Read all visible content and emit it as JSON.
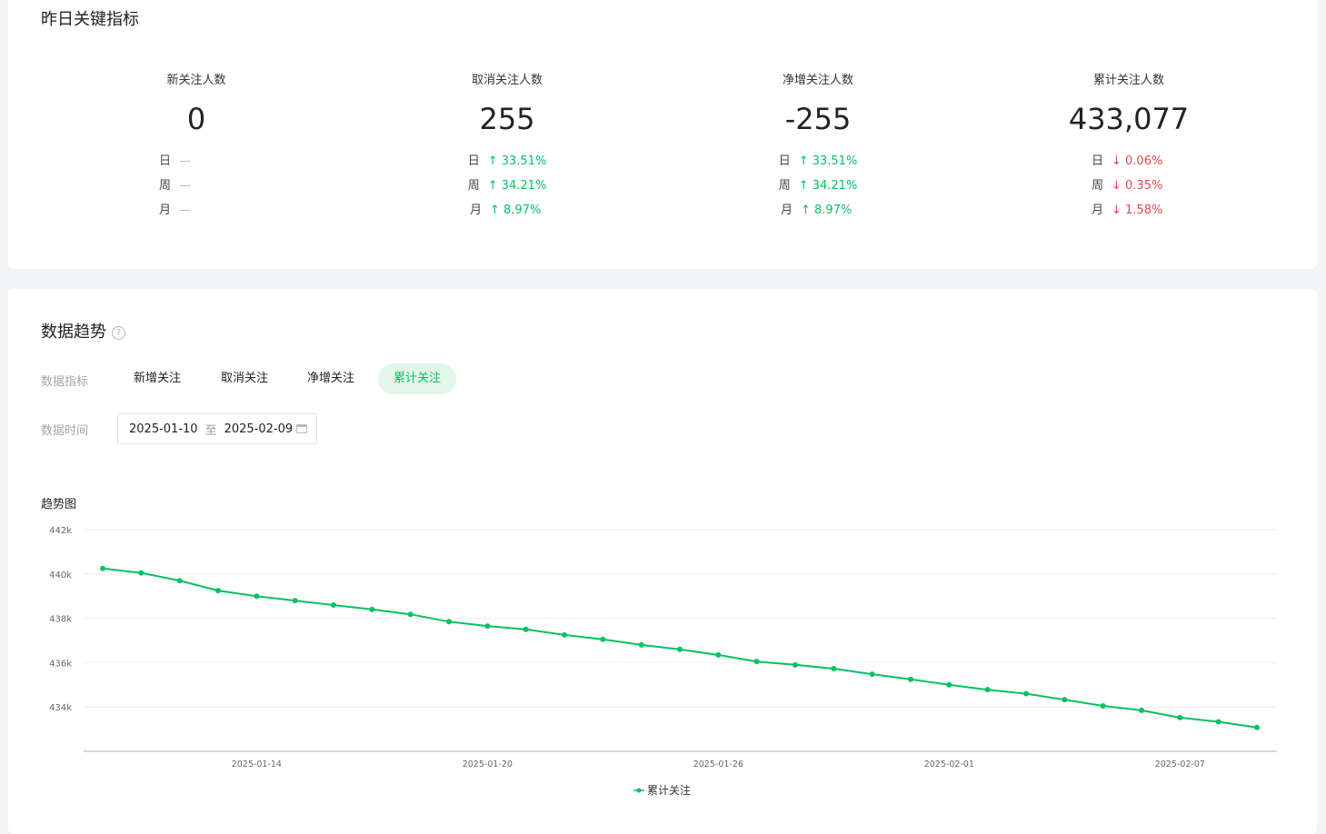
{
  "metrics_section": {
    "title": "昨日关键指标",
    "cards": [
      {
        "label": "新关注人数",
        "value": "0",
        "compare": [
          {
            "label": "日",
            "value": "—",
            "trend": "none"
          },
          {
            "label": "周",
            "value": "—",
            "trend": "none"
          },
          {
            "label": "月",
            "value": "—",
            "trend": "none"
          }
        ]
      },
      {
        "label": "取消关注人数",
        "value": "255",
        "compare": [
          {
            "label": "日",
            "value": "↑ 33.51%",
            "trend": "up"
          },
          {
            "label": "周",
            "value": "↑ 34.21%",
            "trend": "up"
          },
          {
            "label": "月",
            "value": "↑ 8.97%",
            "trend": "up"
          }
        ]
      },
      {
        "label": "净增关注人数",
        "value": "-255",
        "compare": [
          {
            "label": "日",
            "value": "↑ 33.51%",
            "trend": "up"
          },
          {
            "label": "周",
            "value": "↑ 34.21%",
            "trend": "up"
          },
          {
            "label": "月",
            "value": "↑ 8.97%",
            "trend": "up"
          }
        ]
      },
      {
        "label": "累计关注人数",
        "value": "433,077",
        "compare": [
          {
            "label": "日",
            "value": "↓ 0.06%",
            "trend": "down"
          },
          {
            "label": "周",
            "value": "↓ 0.35%",
            "trend": "down"
          },
          {
            "label": "月",
            "value": "↓ 1.58%",
            "trend": "down"
          }
        ]
      }
    ]
  },
  "trend_section": {
    "title": "数据趋势",
    "help_icon": "?",
    "metric_filter_label": "数据指标",
    "tabs": [
      {
        "label": "新增关注",
        "active": false
      },
      {
        "label": "取消关注",
        "active": false
      },
      {
        "label": "净增关注",
        "active": false
      },
      {
        "label": "累计关注",
        "active": true
      }
    ],
    "time_filter_label": "数据时间",
    "date_start": "2025-01-10",
    "date_separator": "至",
    "date_end": "2025-02-09",
    "chart_title": "趋势图"
  },
  "colors": {
    "accent": "#07c160",
    "down": "#e5484d"
  },
  "chart_data": {
    "type": "line",
    "x": [
      "2025-01-10",
      "2025-01-11",
      "2025-01-12",
      "2025-01-13",
      "2025-01-14",
      "2025-01-15",
      "2025-01-16",
      "2025-01-17",
      "2025-01-18",
      "2025-01-19",
      "2025-01-20",
      "2025-01-21",
      "2025-01-22",
      "2025-01-23",
      "2025-01-24",
      "2025-01-25",
      "2025-01-26",
      "2025-01-27",
      "2025-01-28",
      "2025-01-29",
      "2025-01-30",
      "2025-01-31",
      "2025-02-01",
      "2025-02-02",
      "2025-02-03",
      "2025-02-04",
      "2025-02-05",
      "2025-02-06",
      "2025-02-07",
      "2025-02-08",
      "2025-02-09"
    ],
    "x_ticks": [
      "2025-01-14",
      "2025-01-20",
      "2025-01-26",
      "2025-02-01",
      "2025-02-07"
    ],
    "series": [
      {
        "name": "累计关注",
        "color": "#07c160",
        "values": [
          440250,
          440050,
          439700,
          439250,
          439000,
          438800,
          438600,
          438400,
          438180,
          437850,
          437650,
          437500,
          437250,
          437050,
          436800,
          436600,
          436350,
          436050,
          435900,
          435730,
          435480,
          435250,
          435000,
          434780,
          434600,
          434330,
          434050,
          433850,
          433520,
          433330,
          433077
        ]
      }
    ],
    "y_ticks": [
      434000,
      436000,
      438000,
      440000,
      442000
    ],
    "y_tick_labels": [
      "434k",
      "436k",
      "438k",
      "440k",
      "442k"
    ],
    "ylim": [
      432000,
      442000
    ],
    "grid": true,
    "legend": "bottom-center"
  }
}
